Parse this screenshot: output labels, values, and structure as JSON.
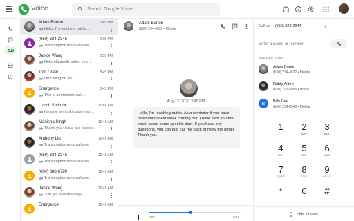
{
  "app": {
    "title": "Voice"
  },
  "search": {
    "placeholder": "Search Google Voice"
  },
  "conversations": [
    {
      "name": "Adam Burton",
      "time": "3:45 PM",
      "snippet": "Hello, I'm reaching out to ...",
      "avatar": "photo-gray"
    },
    {
      "name": "(650) 324-2345",
      "time": "9:05 PM",
      "snippet": "Transcription not available",
      "avatar": "purple"
    },
    {
      "name": "Janice Wang",
      "time": "8:50 PM",
      "snippet": "Hello elizabeth, when you ...",
      "avatar": "photo-warm"
    },
    {
      "name": "Tom Greer",
      "time": "8:45 PM",
      "snippet": "I'm calling on you ...",
      "avatar": "photo-red"
    },
    {
      "name": "Energence",
      "time": "3:45 PM",
      "snippet": "This is a reminder call ...",
      "avatar": "orange"
    },
    {
      "name": "Uzoch Smirnov",
      "time": "10:45 AM",
      "snippet": "I'm sure we looking by your ...",
      "avatar": "photo-dark"
    },
    {
      "name": "Manisha Singh",
      "time": "10:45 AM",
      "snippet": "Thank you I have two places...",
      "avatar": "photo-warm"
    },
    {
      "name": "Anthony Liu",
      "time": "10:45 AM",
      "snippet": "Transcription not available",
      "avatar": "photo-dark"
    },
    {
      "name": "(650) 324-2345",
      "time": "10:45 AM",
      "snippet": "Transcription not available",
      "avatar": "gray"
    },
    {
      "name": "(604) 888-6789",
      "time": "10:45 AM",
      "snippet": "Transcription not available",
      "avatar": "orange"
    },
    {
      "name": "Janice Wang",
      "time": "10:45 AM",
      "snippet": "Just got your message ...",
      "avatar": "photo-warm"
    },
    {
      "name": "Energence",
      "time": "10:45 AM",
      "snippet": "",
      "avatar": "orange"
    }
  ],
  "thread": {
    "name": "Adam Burton",
    "phone": "(650) 234-4532 • Mobile",
    "date": "Aug 12, 2020 3:45 PM",
    "message": "Hello, I'm reaching out to. As a reminder if you have reservation next week coming out. I have sent you the email about serds specific plan. If you have any questions, you can just call me back or reply the email. Thank you."
  },
  "player": {
    "elapsed": "0:00",
    "duration": "0:34",
    "progress": 0.45
  },
  "dialer": {
    "call_as_label": "Call as",
    "call_as_number": "(650) 322-2944",
    "input_placeholder": "Enter a name or number",
    "suggestions_header": "SUGGESTIONS",
    "suggestions": [
      {
        "name": "Adam Burton",
        "phone": "(650) 234-4532 • Mobile"
      },
      {
        "name": "Rubty Aiden",
        "phone": "(650) 222-5686 • Home"
      },
      {
        "name": "Billy Gee",
        "phone": "(650) 234-6543 • Mobile",
        "initial": "B"
      }
    ],
    "keys": [
      {
        "d": "1",
        "l": ""
      },
      {
        "d": "2",
        "l": "ABC"
      },
      {
        "d": "3",
        "l": "DEF"
      },
      {
        "d": "4",
        "l": "GHI"
      },
      {
        "d": "5",
        "l": "JKL"
      },
      {
        "d": "6",
        "l": "MNO"
      },
      {
        "d": "7",
        "l": "PQRS"
      },
      {
        "d": "8",
        "l": "TUV"
      },
      {
        "d": "9",
        "l": "WXYZ"
      },
      {
        "d": "*",
        "l": ""
      },
      {
        "d": "0",
        "l": "+"
      },
      {
        "d": "#",
        "l": ""
      }
    ],
    "hide_label": "Hide keypad"
  },
  "colors": {
    "accent": "#1a73e8",
    "brand_green": "#34a853",
    "purple": "#8e24aa",
    "orange": "#f9ab00"
  }
}
